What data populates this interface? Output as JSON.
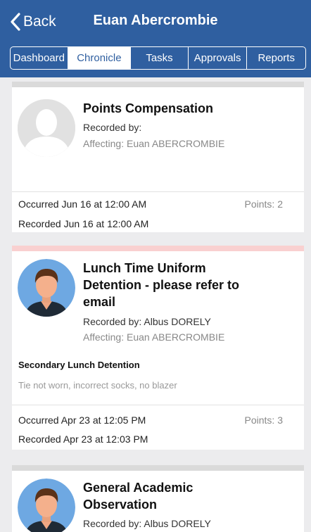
{
  "nav": {
    "back_label": "Back",
    "title": "Euan Abercrombie",
    "background": "#2f5fa0"
  },
  "tabs": [
    {
      "label": "Dashboard",
      "active": false
    },
    {
      "label": "Chronicle",
      "active": true
    },
    {
      "label": "Tasks",
      "active": false
    },
    {
      "label": "Approvals",
      "active": false
    },
    {
      "label": "Reports",
      "active": false
    }
  ],
  "entries": [
    {
      "title": "Points Compensation",
      "recorded_by": "Recorded by:",
      "affecting": "Affecting: Euan ABERCROMBIE",
      "occurred": "Occurred Jun 16 at 12:00 AM",
      "recorded": "Recorded Jun 16 at 12:00 AM",
      "points": "Points: 2",
      "avatar": "placeholder-person-icon",
      "strip_color": "#dadada"
    },
    {
      "title_lines": [
        "Lunch Time Uniform",
        "Detention - please refer to",
        "email"
      ],
      "recorded_by": "Recorded by: Albus DORELY",
      "affecting": "Affecting: Euan ABERCROMBIE",
      "category": "Secondary Lunch Detention",
      "note": "Tie not worn, incorrect socks, no blazer",
      "occurred": "Occurred Apr 23 at 12:05 PM",
      "recorded": "Recorded Apr 23 at 12:03 PM",
      "points": "Points: 3",
      "avatar": "student-avatar-icon",
      "strip_color": "#f9d0d0"
    },
    {
      "title_lines": [
        "General Academic",
        "Observation"
      ],
      "recorded_by": "Recorded by: Albus DORELY",
      "avatar": "student-avatar-icon",
      "strip_color": "#dadada"
    }
  ]
}
